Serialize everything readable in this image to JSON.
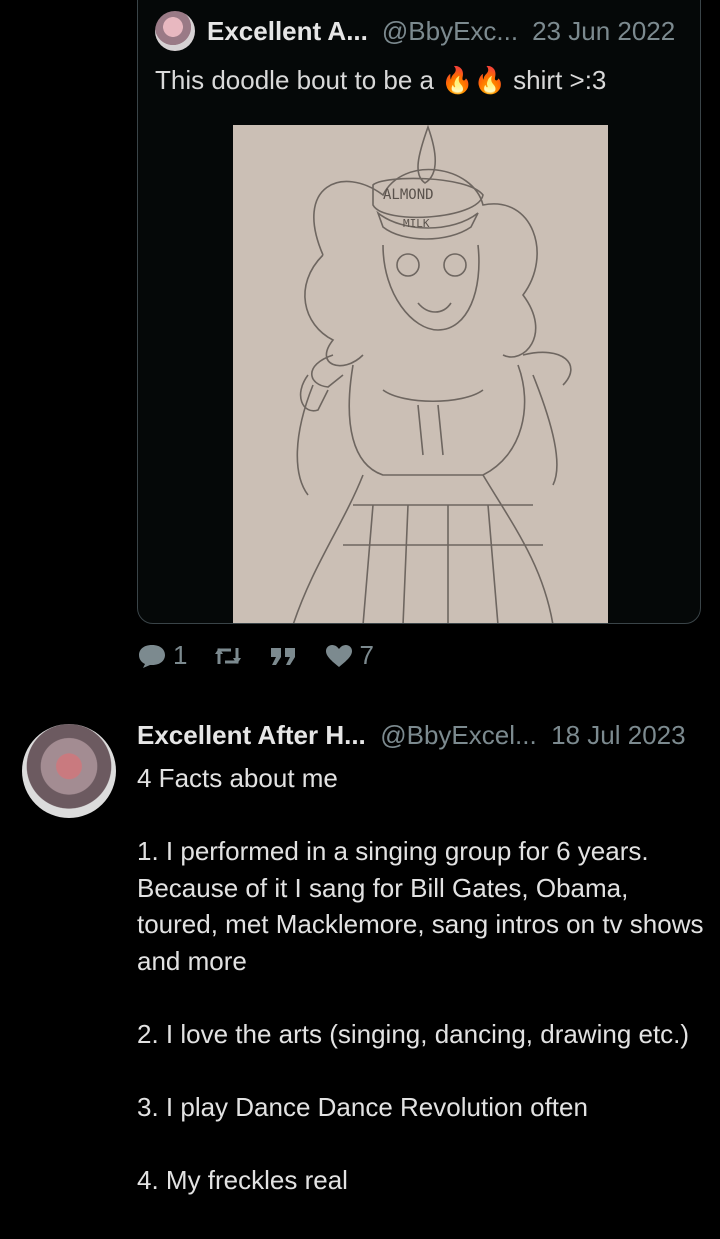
{
  "quoted": {
    "name": "Excellent A...",
    "handle": "@BbyExc...",
    "date": "23 Jun 2022",
    "text_before": "This doodle bout to be a ",
    "emoji": "🔥🔥",
    "text_after": " shirt >:3",
    "image_text_1": "ALMOND",
    "image_text_2": "MILK"
  },
  "actions": {
    "reply_count": "1",
    "like_count": "7"
  },
  "tweet": {
    "name": "Excellent After H...",
    "handle": "@BbyExcel...",
    "date": "18 Jul 2023",
    "body": "4 Facts about me\n\n1. I performed in a singing group for 6 years. Because of it I sang for Bill Gates, Obama, toured, met Macklemore, sang intros on tv shows and more\n\n2. I love the arts (singing, dancing, drawing etc.)\n\n3. I play Dance Dance Revolution often\n\n4. My freckles real"
  },
  "colors": {
    "background": "#000000",
    "muted": "#7c8a8f",
    "card_border": "#3a4448"
  }
}
